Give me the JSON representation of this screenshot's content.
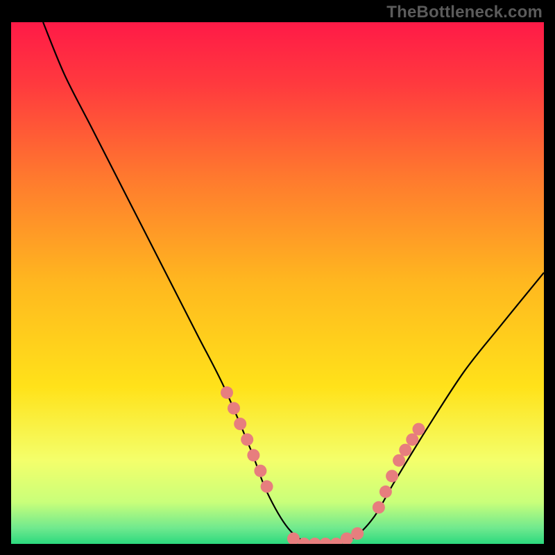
{
  "watermark": "TheBottleneck.com",
  "chart_data": {
    "type": "line",
    "title": "",
    "xlabel": "",
    "ylabel": "",
    "xlim": [
      0,
      100
    ],
    "ylim": [
      0,
      100
    ],
    "grid": false,
    "legend": false,
    "background_gradient_top": "#ff1a47",
    "background_gradient_mid": "#ffd400",
    "background_gradient_low": "#f4ff6b",
    "background_gradient_bottom": "#2bd97e",
    "series": [
      {
        "name": "bottleneck-curve",
        "color": "#000000",
        "x": [
          6,
          10,
          15,
          20,
          25,
          30,
          35,
          40,
          45,
          48,
          52,
          56,
          60,
          64,
          68,
          72,
          78,
          85,
          92,
          100
        ],
        "y": [
          100,
          90,
          80,
          70,
          60,
          50,
          40,
          30,
          18,
          10,
          3,
          0,
          0,
          1,
          5,
          12,
          22,
          33,
          42,
          52
        ]
      },
      {
        "name": "highlight-dots-left",
        "type": "scatter",
        "color": "#e77e7e",
        "x": [
          40.5,
          41.8,
          43.0,
          44.3,
          45.5,
          46.8,
          48.0
        ],
        "y": [
          29,
          26,
          23,
          20,
          17,
          14,
          11
        ]
      },
      {
        "name": "highlight-dots-bottom",
        "type": "scatter",
        "color": "#e77e7e",
        "x": [
          53,
          55,
          57,
          59,
          61,
          63,
          65
        ],
        "y": [
          1,
          0,
          0,
          0,
          0,
          1,
          2
        ]
      },
      {
        "name": "highlight-dots-right",
        "type": "scatter",
        "color": "#e77e7e",
        "x": [
          69.0,
          70.3,
          71.5,
          72.8,
          74.0,
          75.3,
          76.5
        ],
        "y": [
          7,
          10,
          13,
          16,
          18,
          20,
          22
        ]
      }
    ]
  }
}
